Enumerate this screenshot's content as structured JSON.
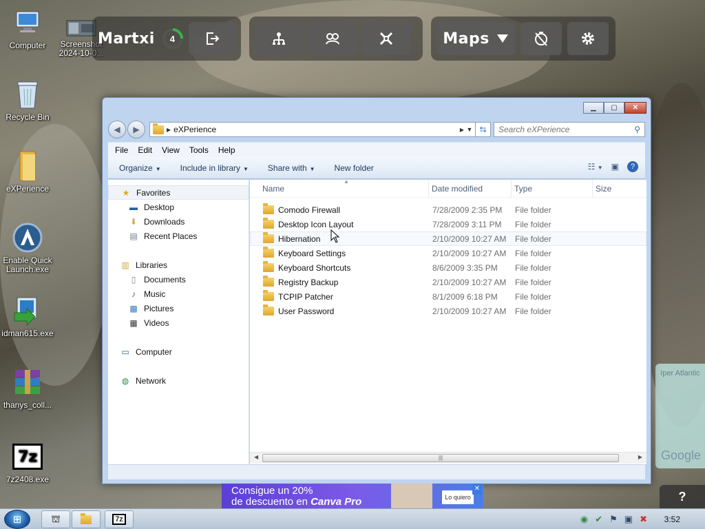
{
  "desktop": {
    "icons": [
      {
        "label": "Computer"
      },
      {
        "label": "Screenshot 2024-10-0..."
      },
      {
        "label": "Recycle Bin"
      },
      {
        "label": "eXPerience"
      },
      {
        "label": "Enable Quick Launch.exe"
      },
      {
        "label": "idman615.exe"
      },
      {
        "label": "thanys_coll..."
      },
      {
        "label": "7z2408.exe"
      }
    ]
  },
  "overlay": {
    "user_name": "Martxi",
    "level": "4",
    "maps_label": "Maps",
    "help": "?"
  },
  "map_tile": {
    "text": "Iper Atlantic",
    "brand": "Google"
  },
  "window": {
    "address_path": "eXPerience",
    "search_placeholder": "Search eXPerience",
    "menu": [
      "File",
      "Edit",
      "View",
      "Tools",
      "Help"
    ],
    "commands": [
      "Organize",
      "Include in library",
      "Share with",
      "New folder"
    ],
    "nav": {
      "favorites": {
        "label": "Favorites",
        "items": [
          "Desktop",
          "Downloads",
          "Recent Places"
        ]
      },
      "libraries": {
        "label": "Libraries",
        "items": [
          "Documents",
          "Music",
          "Pictures",
          "Videos"
        ]
      },
      "computer": "Computer",
      "network": "Network"
    },
    "columns": [
      "Name",
      "Date modified",
      "Type",
      "Size"
    ],
    "files": [
      {
        "name": "Comodo Firewall",
        "date": "7/28/2009 2:35 PM",
        "type": "File folder"
      },
      {
        "name": "Desktop Icon Layout",
        "date": "7/28/2009 3:11 PM",
        "type": "File folder"
      },
      {
        "name": "Hibernation",
        "date": "2/10/2009 10:27 AM",
        "type": "File folder"
      },
      {
        "name": "Keyboard Settings",
        "date": "2/10/2009 10:27 AM",
        "type": "File folder"
      },
      {
        "name": "Keyboard Shortcuts",
        "date": "8/6/2009 3:35 PM",
        "type": "File folder"
      },
      {
        "name": "Registry Backup",
        "date": "2/10/2009 10:27 AM",
        "type": "File folder"
      },
      {
        "name": "TCPIP Patcher",
        "date": "8/1/2009 6:18 PM",
        "type": "File folder"
      },
      {
        "name": "User Password",
        "date": "2/10/2009 10:27 AM",
        "type": "File folder"
      }
    ]
  },
  "ad": {
    "line1": "Consigue un 20%",
    "line2_prefix": "de descuento en ",
    "brand": "Canva Pro",
    "button": "Lo quiero"
  },
  "taskbar": {
    "items": [
      "file-explorer",
      "folder",
      "7z"
    ],
    "label_7z": "7z",
    "clock": "3:52"
  }
}
